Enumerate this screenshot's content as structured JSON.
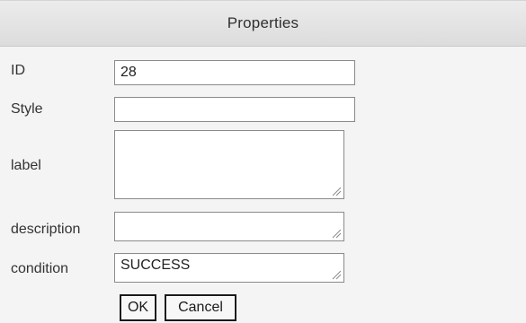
{
  "window": {
    "title": "Properties"
  },
  "form": {
    "id": {
      "label": "ID",
      "value": "28"
    },
    "style": {
      "label": "Style",
      "value": ""
    },
    "label": {
      "label": "label",
      "value": ""
    },
    "description": {
      "label": "description",
      "value": ""
    },
    "condition": {
      "label": "condition",
      "value": "SUCCESS"
    }
  },
  "buttons": {
    "ok": "OK",
    "cancel": "Cancel"
  }
}
